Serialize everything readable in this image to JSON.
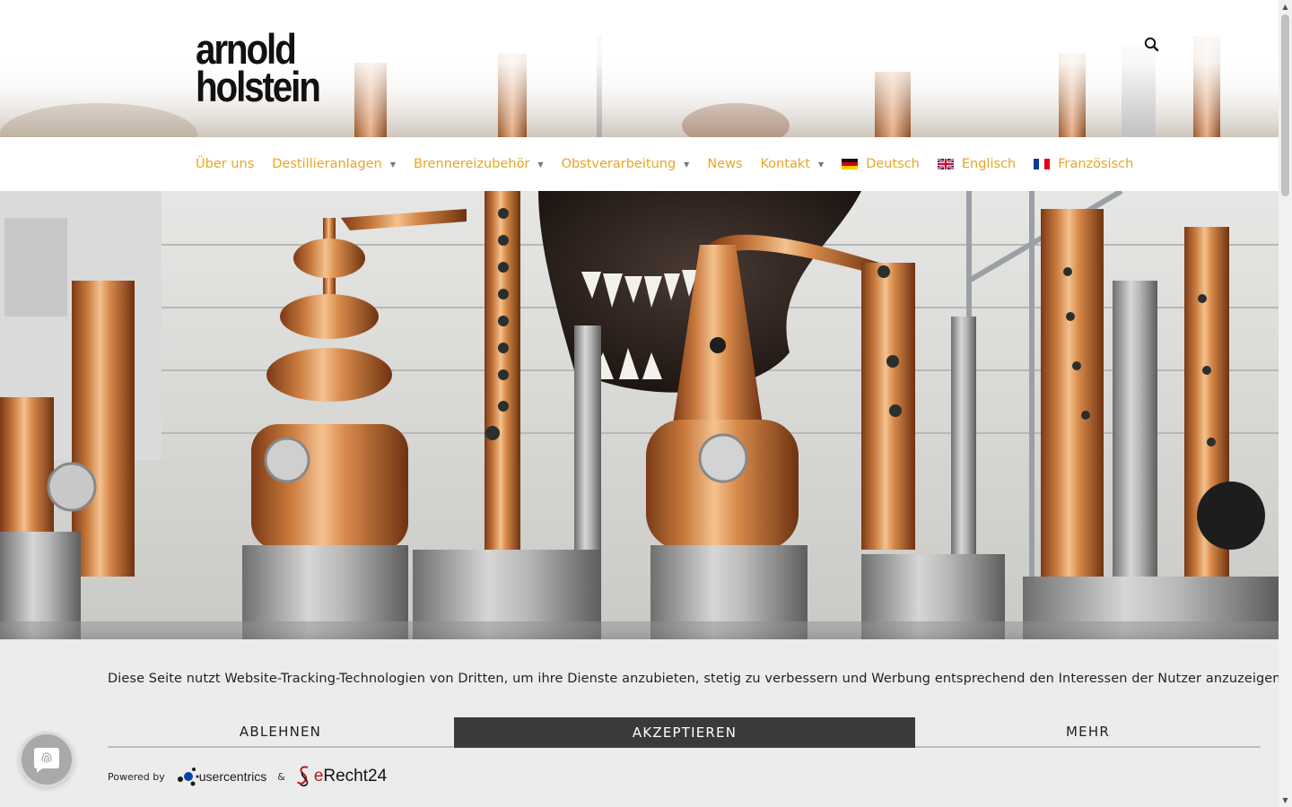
{
  "logo": {
    "line1": "arnold",
    "line2": "holstein"
  },
  "nav": {
    "items": [
      {
        "label": "Über uns",
        "has_dropdown": false
      },
      {
        "label": "Destillieranlagen",
        "has_dropdown": true
      },
      {
        "label": "Brennereizubehör",
        "has_dropdown": true
      },
      {
        "label": "Obstverarbeitung",
        "has_dropdown": true
      },
      {
        "label": "News",
        "has_dropdown": false
      },
      {
        "label": "Kontakt",
        "has_dropdown": true
      }
    ],
    "languages": [
      {
        "label": "Deutsch",
        "flag": "flag-de-icon"
      },
      {
        "label": "Englisch",
        "flag": "flag-gb-icon"
      },
      {
        "label": "Französisch",
        "flag": "flag-fr-icon"
      }
    ],
    "caret": "▼"
  },
  "search": {
    "icon": "search-icon"
  },
  "hero": {
    "subject": "copper-distillation-stills-photo"
  },
  "cookie_banner": {
    "text": "Diese Seite nutzt Website-Tracking-Technologien von Dritten, um ihre Dienste anzubieten, stetig zu verbessern und Werbung entsprechend den Interessen der Nutzer anzuzeigen.",
    "decline_label": "ABLEHNEN",
    "accept_label": "AKZEPTIEREN",
    "more_label": "MEHR",
    "powered_by": "Powered by",
    "usercentrics": "usercentrics",
    "ampersand": "&",
    "erecht_e": "e",
    "erecht_rest": "Recht24"
  },
  "scrollbar": {
    "up": "▲",
    "down": "▼"
  },
  "colors": {
    "nav_link": "#e8a623",
    "accept_bg": "#3a3a3a",
    "banner_bg": "#ececec",
    "erecht_red": "#c0151b"
  }
}
